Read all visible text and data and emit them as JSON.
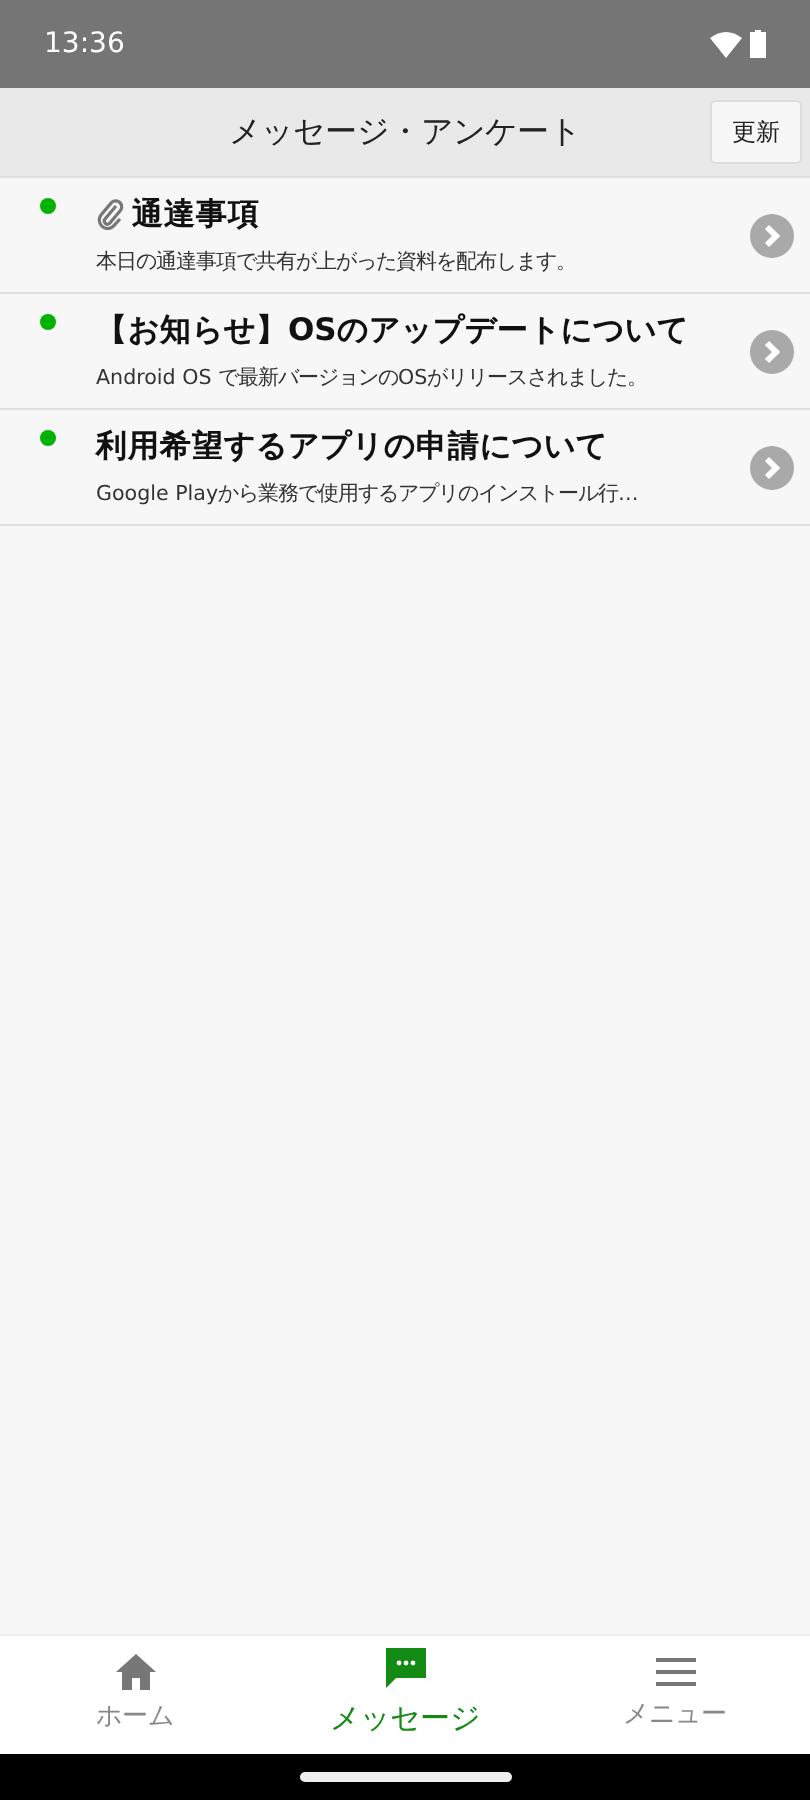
{
  "status_bar": {
    "time": "13:36"
  },
  "header": {
    "title": "メッセージ・アンケート",
    "refresh_button": "更新"
  },
  "messages": [
    {
      "title": "通達事項",
      "summary": "本日の通達事項で共有が上がった資料を配布します。",
      "unread": true,
      "attachment": true
    },
    {
      "title": "【お知らせ】OSのアップデートについて",
      "summary": "Android OS で最新バージョンのOSがリリースされました。",
      "unread": true,
      "attachment": false
    },
    {
      "title": "利用希望するアプリの申請について",
      "summary": "Google Playから業務で使用するアプリのインストール行…",
      "unread": true,
      "attachment": false
    }
  ],
  "bottom_nav": [
    {
      "label": "ホーム",
      "kind": "home",
      "selected": false
    },
    {
      "label": "メッセージ",
      "kind": "message",
      "selected": true
    },
    {
      "label": "メニュー",
      "kind": "menu",
      "selected": false
    }
  ]
}
